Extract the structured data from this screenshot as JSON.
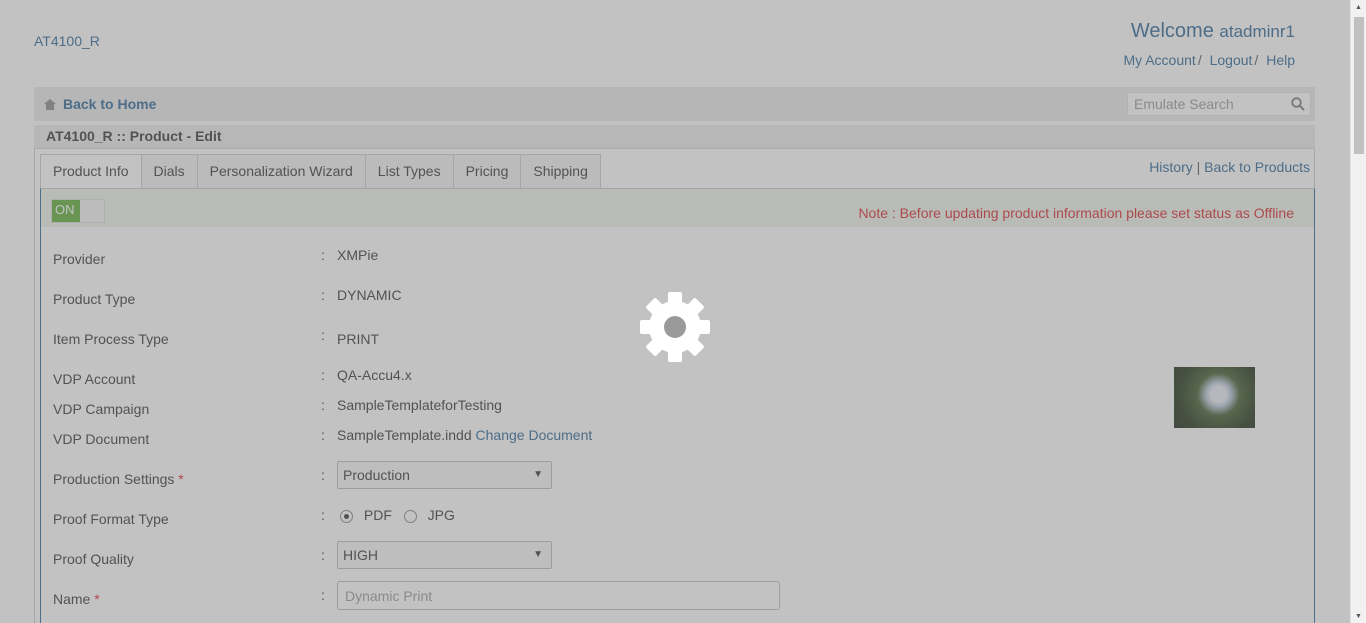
{
  "header": {
    "brand": "AT4100_R",
    "welcome_label": "Welcome",
    "username": "atadminr1",
    "links": [
      "My Account",
      "Logout",
      "Help"
    ],
    "separator": "/"
  },
  "navbar": {
    "home_label": "Back to Home",
    "search_placeholder": "Emulate Search"
  },
  "breadcrumb": "AT4100_R :: Product - Edit",
  "tabs": [
    {
      "label": "Product Info",
      "active": true
    },
    {
      "label": "Dials",
      "active": false
    },
    {
      "label": "Personalization Wizard",
      "active": false
    },
    {
      "label": "List Types",
      "active": false
    },
    {
      "label": "Pricing",
      "active": false
    },
    {
      "label": "Shipping",
      "active": false
    }
  ],
  "right_links": {
    "history": "History",
    "separator": "|",
    "back_to_products": "Back to Products"
  },
  "status": {
    "toggle_label": "ON",
    "note": "Note : Before updating product information please set status as Offline"
  },
  "form": {
    "colon": ":",
    "required_mark": "*",
    "provider": {
      "label": "Provider",
      "value": "XMPie"
    },
    "product_type": {
      "label": "Product Type",
      "value": "DYNAMIC"
    },
    "item_process_type": {
      "label": "Item Process Type",
      "value": "PRINT"
    },
    "vdp_account": {
      "label": "VDP Account",
      "value": "QA-Accu4.x"
    },
    "vdp_campaign": {
      "label": "VDP Campaign",
      "value": "SampleTemplateforTesting"
    },
    "vdp_document": {
      "label": "VDP Document",
      "value": "SampleTemplate.indd",
      "link": "Change Document"
    },
    "production_settings": {
      "label": "Production Settings",
      "value": "Production"
    },
    "proof_format_type": {
      "label": "Proof Format Type",
      "options": [
        "PDF",
        "JPG"
      ],
      "selected": "PDF"
    },
    "proof_quality": {
      "label": "Proof Quality",
      "value": "HIGH"
    },
    "name": {
      "label": "Name",
      "placeholder": "Dynamic Print"
    }
  },
  "colors": {
    "link": "#2a6496",
    "toggle_on": "#5cae33",
    "note": "#d9242b",
    "overlay": "rgba(120,120,120,0.45)"
  },
  "icons": {
    "home": "home-icon",
    "search": "search-icon",
    "loading": "gear-icon",
    "select_arrow": "▼"
  }
}
